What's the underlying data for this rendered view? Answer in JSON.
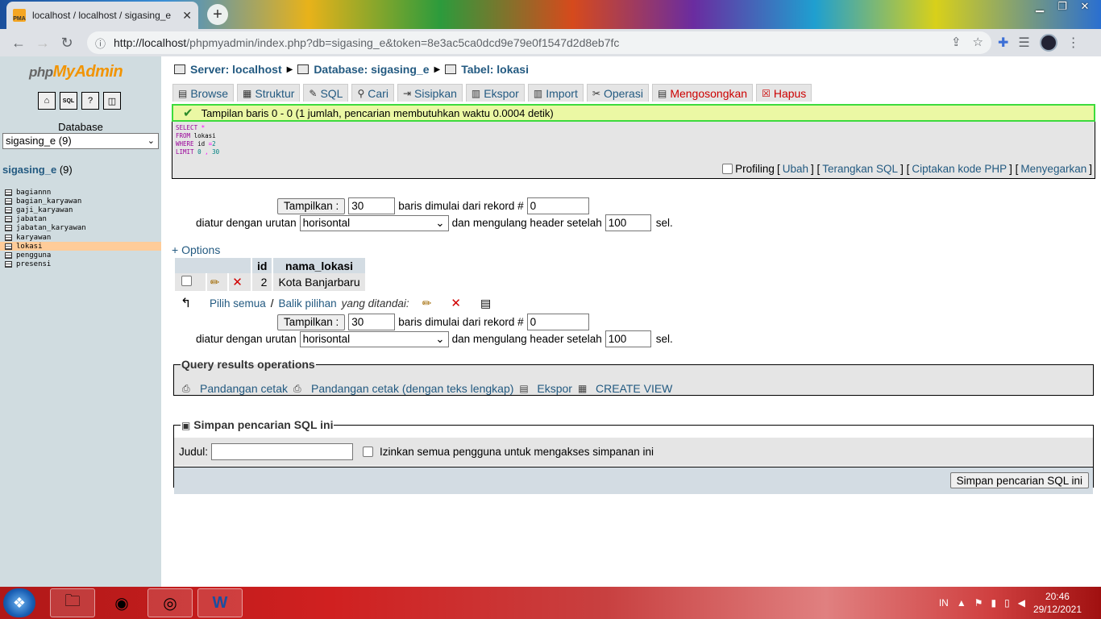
{
  "browser": {
    "tab_title": "localhost / localhost / sigasing_e",
    "url_host": "http://localhost",
    "url_rest": "/phpmyadmin/index.php?db=sigasing_e&token=8e3ac5ca0dcd9e79e0f1547d2d8eb7fc"
  },
  "left": {
    "logo_php": "php",
    "logo_my": "MyAdmin",
    "db_label": "Database",
    "db_selected": "sigasing_e (9)",
    "db_name": "sigasing_e",
    "db_count": "(9)",
    "tables": [
      "bagiannn",
      "bagian_karyawan",
      "gaji_karyawan",
      "jabatan",
      "jabatan_karyawan",
      "karyawan",
      "lokasi",
      "pengguna",
      "presensi"
    ],
    "active_table": "lokasi"
  },
  "breadcrumb": {
    "server": "Server: localhost",
    "database": "Database: sigasing_e",
    "table": "Tabel: lokasi"
  },
  "tabs": [
    "Browse",
    "Struktur",
    "SQL",
    "Cari",
    "Sisipkan",
    "Ekspor",
    "Import",
    "Operasi",
    "Mengosongkan",
    "Hapus"
  ],
  "notice": "Tampilan baris 0 - 0 (1 jumlah, pencarian membutuhkan waktu 0.0004 detik)",
  "sql": {
    "select": "SELECT",
    "star": "*",
    "from": "FROM",
    "table": "lokasi",
    "where": "WHERE",
    "cond_col": "id",
    "cond_op": "=",
    "cond_val": "2",
    "limit": "LIMIT",
    "limit_a": "0",
    "limit_sep": ",",
    "limit_b": "30"
  },
  "sql_links": {
    "profiling": "Profiling",
    "ubah": "Ubah",
    "terangkan": "Terangkan SQL",
    "ciptakan": "Ciptakan kode PHP",
    "menyegarkan": "Menyegarkan"
  },
  "nav": {
    "show_button": "Tampilkan :",
    "rows_value": "30",
    "from_text": "baris dimulai dari rekord #",
    "start_value": "0",
    "order_text": "diatur dengan urutan",
    "mode_value": "horisontal",
    "repeat_text": "dan mengulang header setelah",
    "repeat_value": "100",
    "cells_text": "sel."
  },
  "options_link": "+ Options",
  "results": {
    "columns": [
      "id",
      "nama_lokasi"
    ],
    "rows": [
      [
        "2",
        "Kota Banjarbaru"
      ]
    ]
  },
  "with_selected": {
    "check_all": "Pilih semua",
    "sep": "/",
    "invert": "Balik pilihan",
    "label": "yang ditandai:"
  },
  "qro": {
    "legend": "Query results operations",
    "print_view": "Pandangan cetak",
    "print_view_full": "Pandangan cetak (dengan teks lengkap)",
    "export": "Ekspor",
    "create_view": "CREATE VIEW"
  },
  "save_sql": {
    "legend": "Simpan pencarian SQL ini",
    "label": "Judul:",
    "allow_all": "Izinkan semua pengguna untuk mengakses simpanan ini",
    "button": "Simpan pencarian SQL ini"
  },
  "taskbar": {
    "lang": "IN",
    "time": "20:46",
    "date": "29/12/2021"
  }
}
